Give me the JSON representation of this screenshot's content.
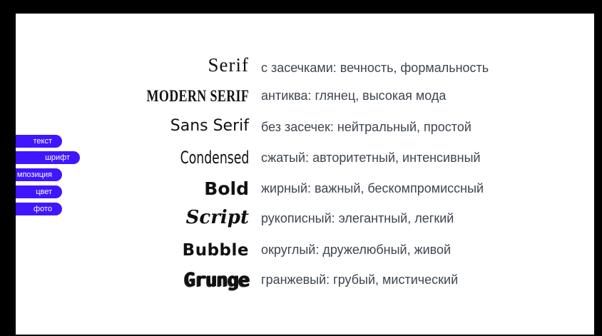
{
  "nav": {
    "items": [
      {
        "label": "текст"
      },
      {
        "label": "шрифт"
      },
      {
        "label": "мпозиция"
      },
      {
        "label": "цвет"
      },
      {
        "label": "фото"
      }
    ],
    "color": "#3f16ff"
  },
  "fonts": [
    {
      "sample": "Serif",
      "description": "с засечками: вечность, формальность"
    },
    {
      "sample": "MODERN SERIF",
      "description": "антиква: глянец, высокая мода"
    },
    {
      "sample": "Sans Serif",
      "description": "без засечек: нейтральный, простой"
    },
    {
      "sample": "Condensed",
      "description": "сжатый: авторитетный, интенсивный"
    },
    {
      "sample": "Bold",
      "description": "жирный: важный, бескомпромиссный"
    },
    {
      "sample": "Script",
      "description": "рукописный: элегантный, легкий"
    },
    {
      "sample": "Bubble",
      "description": "округлый: дружелюбный, живой"
    },
    {
      "sample": "Grunge",
      "description": "гранжевый: грубый, мистический"
    }
  ]
}
